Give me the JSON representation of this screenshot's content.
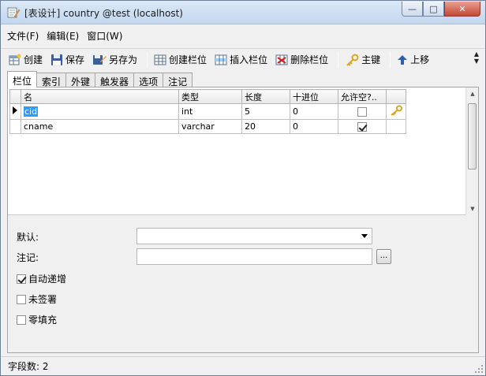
{
  "window": {
    "title": "[表设计] country @test (localhost)",
    "minimize": "—",
    "maximize": "□",
    "close": "✕"
  },
  "menu": [
    "文件(F)",
    "编辑(E)",
    "窗口(W)"
  ],
  "toolbar": {
    "create": "创建",
    "save": "保存",
    "save_as": "另存为",
    "create_field": "创建栏位",
    "insert_field": "插入栏位",
    "delete_field": "删除栏位",
    "primary_key": "主键",
    "move_up": "上移"
  },
  "tabs": [
    "栏位",
    "索引",
    "外键",
    "触发器",
    "选项",
    "注记"
  ],
  "active_tab": 0,
  "grid": {
    "headers": [
      "名",
      "类型",
      "长度",
      "十进位",
      "允许空?..",
      ""
    ],
    "rows": [
      {
        "name": "cid",
        "type": "int",
        "length": "5",
        "decimals": "0",
        "allow_null": false,
        "primary_key": true,
        "selected": true
      },
      {
        "name": "cname",
        "type": "varchar",
        "length": "20",
        "decimals": "0",
        "allow_null": true,
        "primary_key": false,
        "selected": false
      }
    ]
  },
  "properties": {
    "default_label": "默认:",
    "default_value": "",
    "comment_label": "注记:",
    "comment_value": "",
    "ellipsis": "...",
    "auto_increment_label": "自动递增",
    "auto_increment": true,
    "unsigned_label": "未签署",
    "unsigned": false,
    "zerofill_label": "零填充",
    "zerofill": false
  },
  "status": {
    "field_count": "字段数: 2"
  },
  "colors": {
    "selection": "#3399ff",
    "key_icon": "#d8a71e"
  }
}
